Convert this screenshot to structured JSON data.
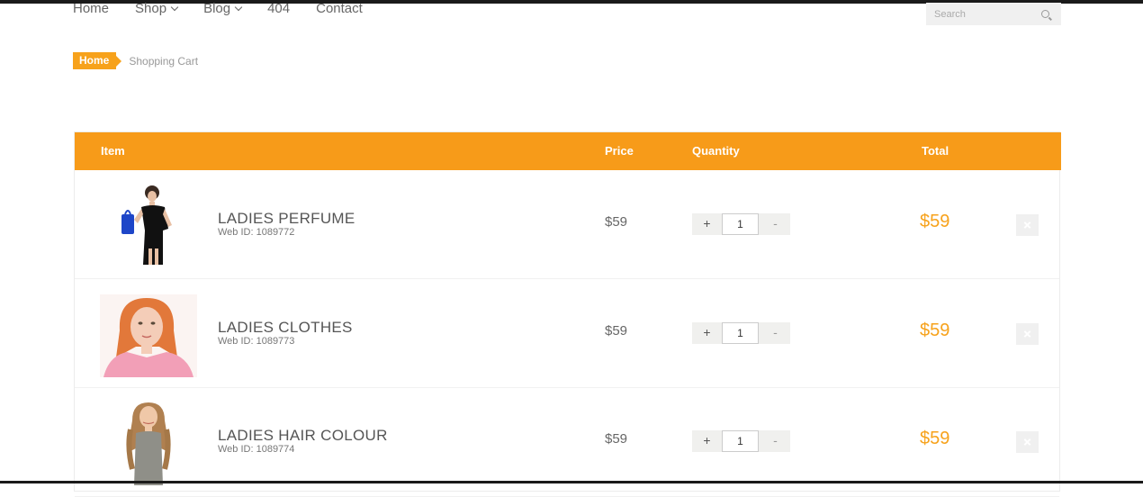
{
  "nav": {
    "items": [
      {
        "label": "Home",
        "has_dropdown": false
      },
      {
        "label": "Shop",
        "has_dropdown": true
      },
      {
        "label": "Blog",
        "has_dropdown": true
      },
      {
        "label": "404",
        "has_dropdown": false
      },
      {
        "label": "Contact",
        "has_dropdown": false
      }
    ],
    "search_placeholder": "Search",
    "search_icon": "search-icon"
  },
  "breadcrumb": {
    "home": "Home",
    "current": "Shopping Cart"
  },
  "cart": {
    "headers": {
      "item": "Item",
      "price": "Price",
      "quantity": "Quantity",
      "total": "Total"
    },
    "rows": [
      {
        "name": "LADIES PERFUME",
        "web_id": "Web ID: 1089772",
        "price": "$59",
        "qty_plus": "+",
        "qty_value": "1",
        "qty_minus": "-",
        "total": "$59",
        "delete_icon": "close-icon"
      },
      {
        "name": "LADIES CLOTHES",
        "web_id": "Web ID: 1089773",
        "price": "$59",
        "qty_plus": "+",
        "qty_value": "1",
        "qty_minus": "-",
        "total": "$59",
        "delete_icon": "close-icon"
      },
      {
        "name": "LADIES HAIR COLOUR",
        "web_id": "Web ID: 1089774",
        "price": "$59",
        "qty_plus": "+",
        "qty_value": "1",
        "qty_minus": "-",
        "total": "$59",
        "delete_icon": "close-icon"
      }
    ]
  },
  "colors": {
    "accent": "#f79b19",
    "text": "#555555"
  }
}
